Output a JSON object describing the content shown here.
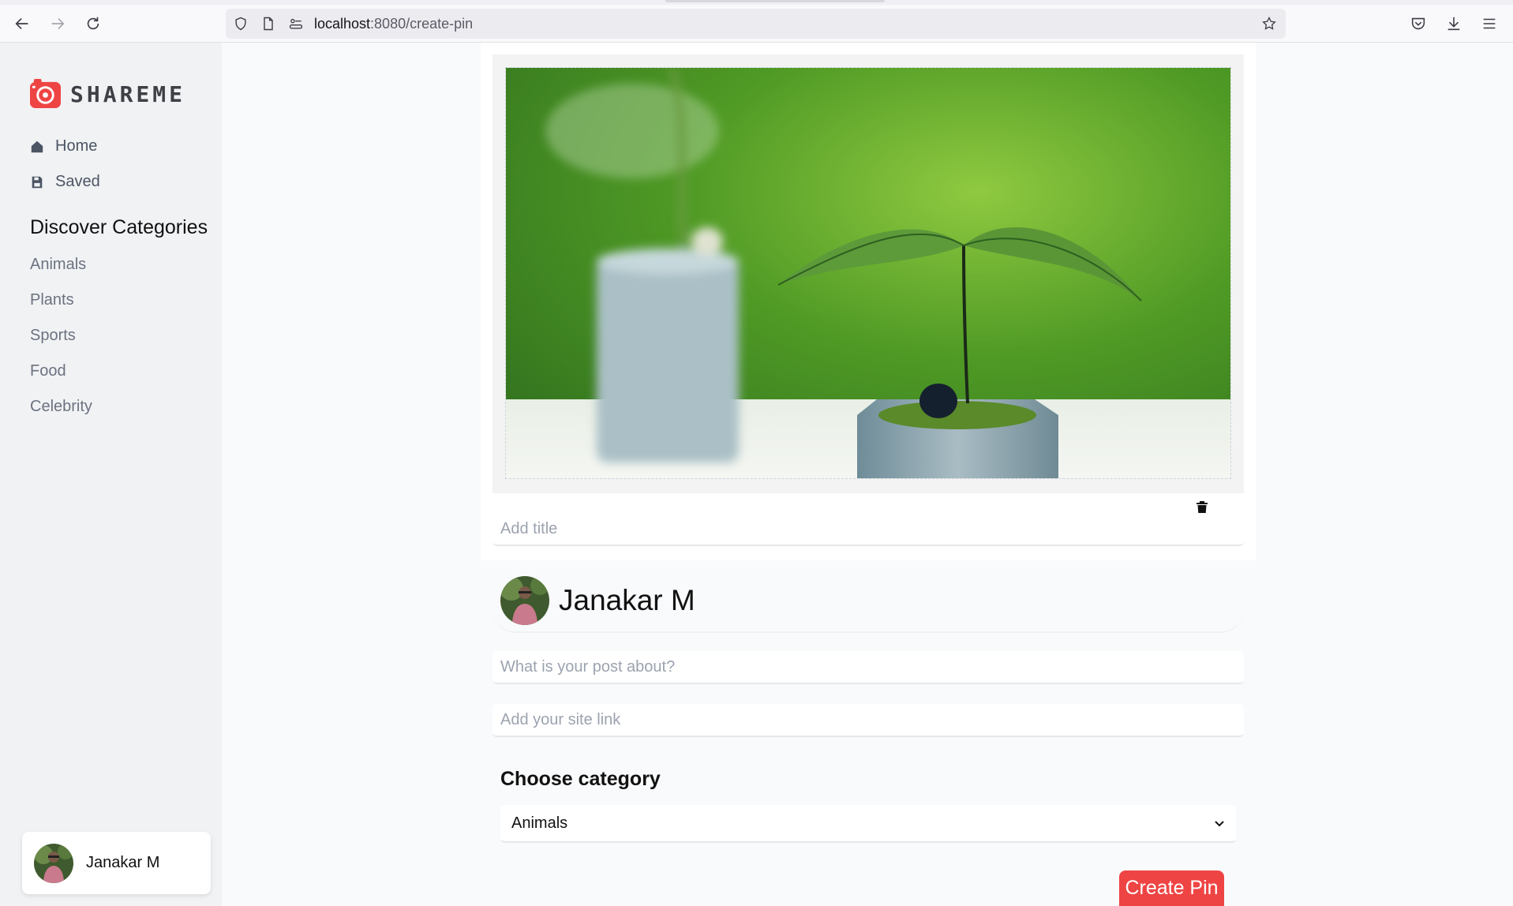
{
  "browser": {
    "url_host": "localhost",
    "url_path": ":8080/create-pin",
    "icons": [
      "back-icon",
      "forward-icon",
      "reload-icon",
      "shield-icon",
      "page-icon",
      "permissions-icon",
      "star-icon",
      "pocket-icon",
      "download-icon",
      "menu-icon"
    ]
  },
  "sidebar": {
    "brand": "SHAREME",
    "nav": [
      {
        "label": "Home",
        "icon": "home-icon"
      },
      {
        "label": "Saved",
        "icon": "save-icon"
      }
    ],
    "categories_heading": "Discover Categories",
    "categories": [
      "Animals",
      "Plants",
      "Sports",
      "Food",
      "Celebrity"
    ],
    "user_name": "Janakar M"
  },
  "form": {
    "title_placeholder": "Add title",
    "author_name": "Janakar M",
    "about_placeholder": "What is your post about?",
    "link_placeholder": "Add your site link",
    "category_label": "Choose category",
    "category_value": "Animals",
    "submit_label": "Create Pin"
  },
  "colors": {
    "accent": "#ef4444",
    "sidebar_bg": "#f1f2f4",
    "page_bg": "#f9fafb"
  }
}
